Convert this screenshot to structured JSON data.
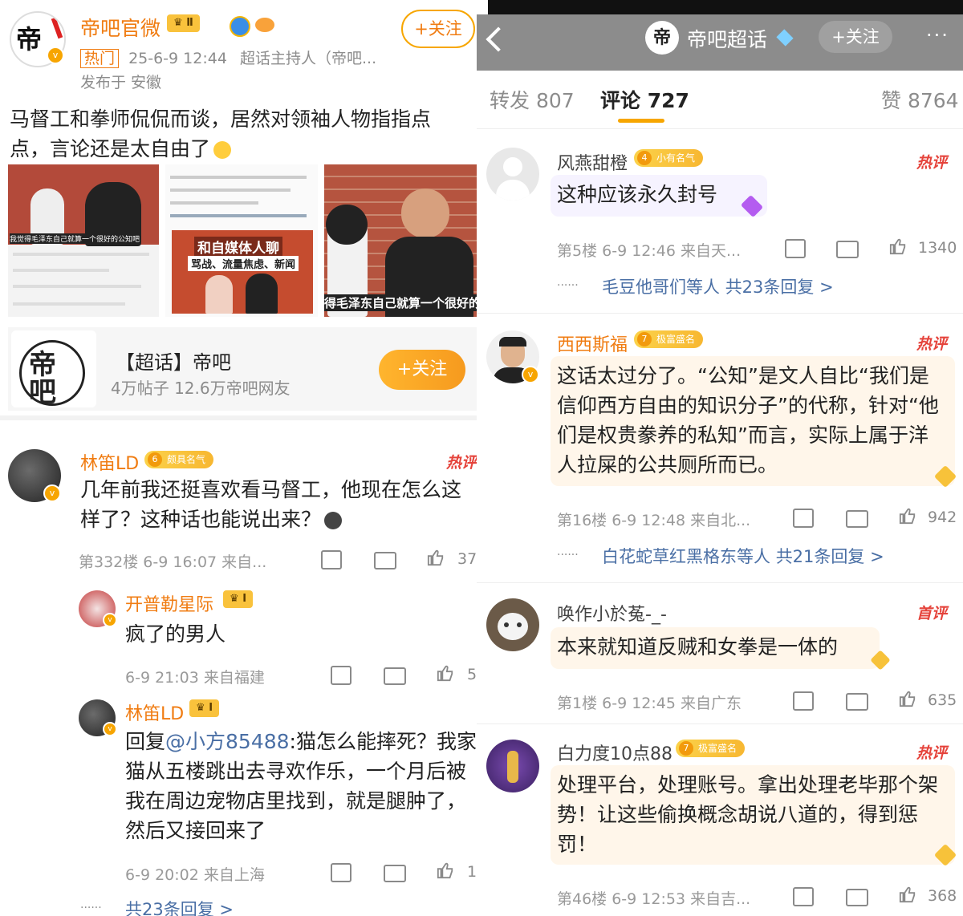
{
  "post": {
    "author": "帝吧官微",
    "level_badge": "Ⅱ",
    "hot_tag": "热门",
    "time": "25-6-9 12:44",
    "role": "超话主持人（帝吧...",
    "location": "发布于 安徽",
    "follow_label": "+关注",
    "text": "马督工和拳师侃侃而谈，居然对领袖人物指指点点，言论还是太自由了",
    "images": [
      {
        "caption": "我觉得毛泽东自己就算一个很好的公知吧"
      },
      {
        "title": "和自媒体人聊",
        "subtitle": "骂战、流量焦虑、新闻"
      },
      {
        "caption": "得毛泽东自己就算一个很好的"
      }
    ]
  },
  "supertopic": {
    "logo": "帝吧",
    "name": "【超话】帝吧",
    "stats": "4万帖子 12.6万帝吧网友",
    "follow_label": "+关注"
  },
  "left_comments": [
    {
      "user": "林笛LD",
      "badge_level": "6",
      "badge_text": "颇具名气",
      "hot": "热评",
      "text": "几年前我还挺喜欢看马督工，他现在怎么这样了？这种话也能说出来？",
      "meta": "第332楼 6-9 16:07 来自...",
      "likes": "37"
    },
    {
      "user": "开普勒星际",
      "level_badge": "Ⅰ",
      "text": "疯了的男人",
      "meta": "6-9 21:03 来自福建",
      "likes": "5"
    },
    {
      "user": "林笛LD",
      "level_badge": "Ⅰ",
      "reply_prefix": "回复",
      "reply_to": "@小方85488",
      "text": ":猫怎么能摔死？我家猫从五楼跳出去寻欢作乐，一个月后被我在周边宠物店里找到，就是腿肿了，然后又接回来了",
      "meta": "6-9 20:02 来自上海",
      "likes": "1"
    }
  ],
  "left_more_replies": "共23条回复 >",
  "header": {
    "title": "帝吧超话",
    "follow_label": "+关注",
    "more": "···"
  },
  "tabs": [
    {
      "label": "转发",
      "count": "807"
    },
    {
      "label": "评论",
      "count": "727"
    },
    {
      "label": "赞",
      "count": "8764"
    }
  ],
  "right_comments": [
    {
      "user": "风燕甜橙",
      "badge_level": "4",
      "badge_text": "小有名气",
      "hot": "热评",
      "text": "这种应该永久封号",
      "meta": "第5楼 6-9 12:46 来自天...",
      "likes": "1340",
      "replies_user": "毛豆他哥们等人",
      "replies_count": "共23条回复 >"
    },
    {
      "user": "西西斯福",
      "badge_level": "7",
      "badge_text": "极富盛名",
      "hot": "热评",
      "text": "这话太过分了。“公知”是文人自比“我们是信仰西方自由的知识分子”的代称，针对“他们是权贵豢养的私知”而言，实际上属于洋人拉屎的公共厕所而已。",
      "meta": "第16楼 6-9 12:48 来自北...",
      "likes": "942",
      "replies_user": "白花蛇草红黑格东等人",
      "replies_count": "共21条回复 >"
    },
    {
      "user": "唤作小於菟-_-",
      "hot": "首评",
      "text": "本来就知道反贼和女拳是一体的",
      "meta": "第1楼 6-9 12:45 来自广东",
      "likes": "635"
    },
    {
      "user": "白力度10点88",
      "badge_level": "7",
      "badge_text": "极富盛名",
      "hot": "热评",
      "text": "处理平台，处理账号。拿出处理老毕那个架势！让这些偷换概念胡说八道的，得到惩罚！",
      "meta": "第46楼 6-9 12:53 来自吉...",
      "likes": "368"
    }
  ],
  "colors": {
    "accent": "#f7a600",
    "name": "#f07c12",
    "link": "#4a6fa5",
    "hot": "#e5433b"
  }
}
